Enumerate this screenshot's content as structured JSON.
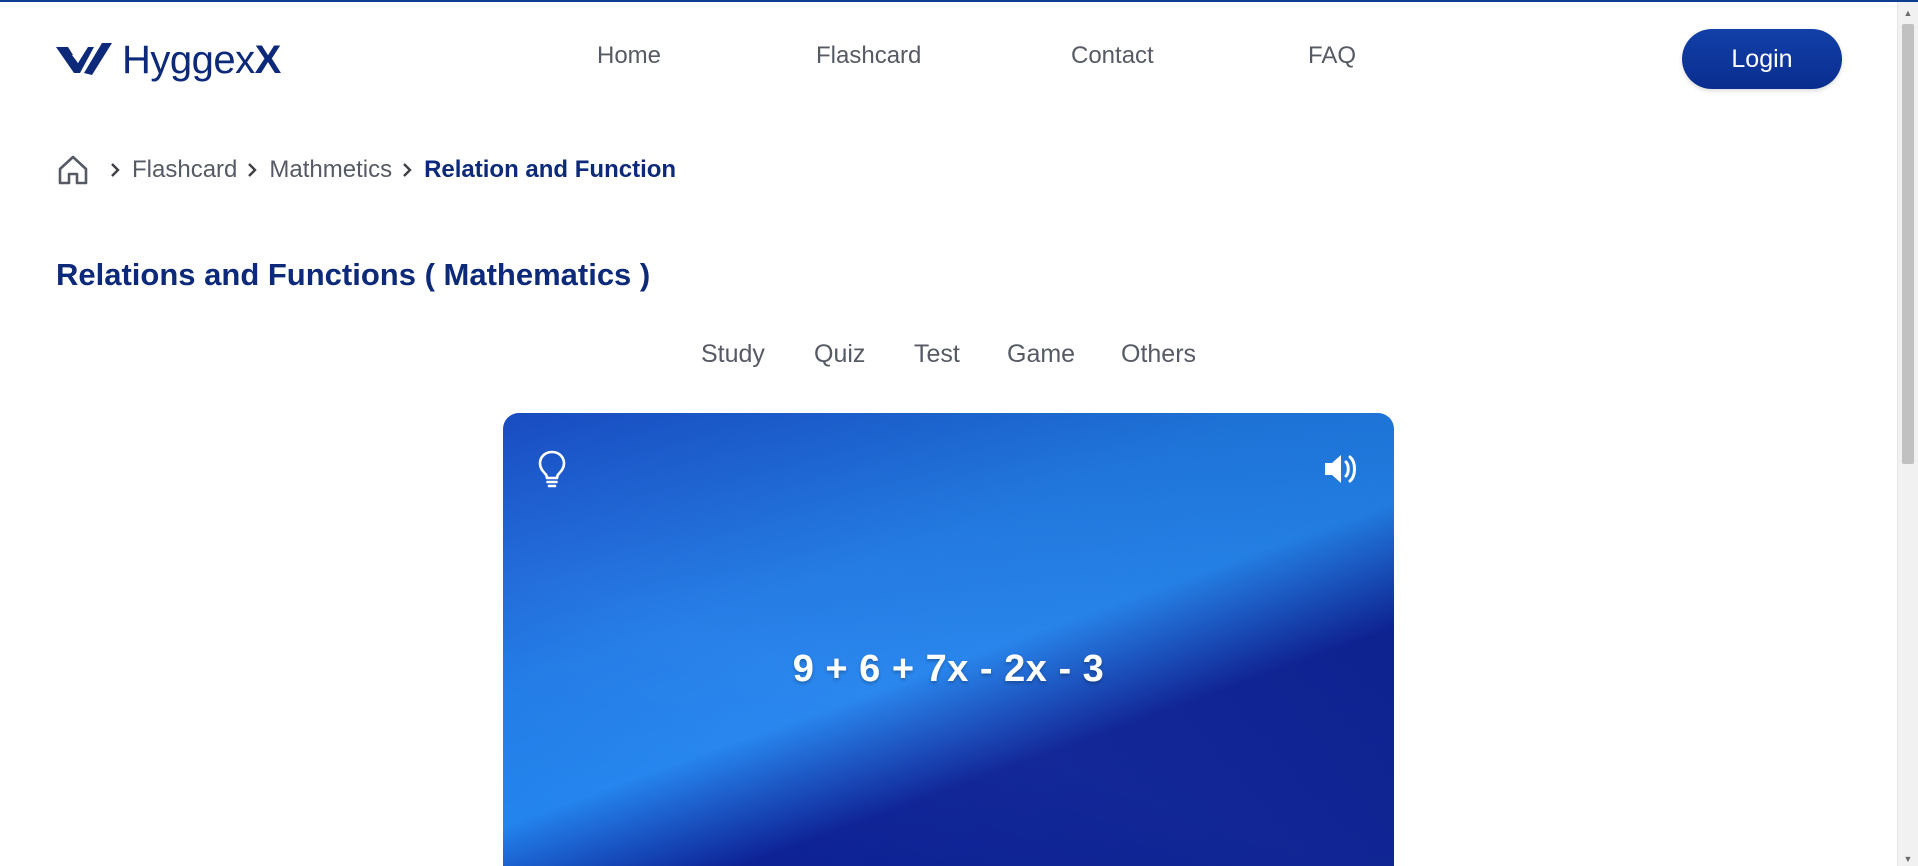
{
  "brand": {
    "name": "Hyggex",
    "name_suffix": "X",
    "color": "#0d2a7a"
  },
  "nav": {
    "items": [
      {
        "label": "Home"
      },
      {
        "label": "Flashcard"
      },
      {
        "label": "Contact"
      },
      {
        "label": "FAQ"
      }
    ],
    "login_label": "Login"
  },
  "breadcrumb": {
    "items": [
      "Flashcard",
      "Mathmetics"
    ],
    "current": "Relation and Function"
  },
  "page": {
    "title": "Relations and Functions ( Mathematics )"
  },
  "tabs": [
    {
      "label": "Study"
    },
    {
      "label": "Quiz"
    },
    {
      "label": "Test"
    },
    {
      "label": "Game"
    },
    {
      "label": "Others"
    }
  ],
  "flashcard": {
    "text": "9 + 6 + 7x - 2x - 3",
    "hint_icon": "lightbulb-icon",
    "sound_icon": "speaker-icon"
  },
  "colors": {
    "accent": "#0d2a7a",
    "button": "#0a2d8f",
    "card_light": "#2283ee",
    "card_dark": "#071d8f"
  }
}
